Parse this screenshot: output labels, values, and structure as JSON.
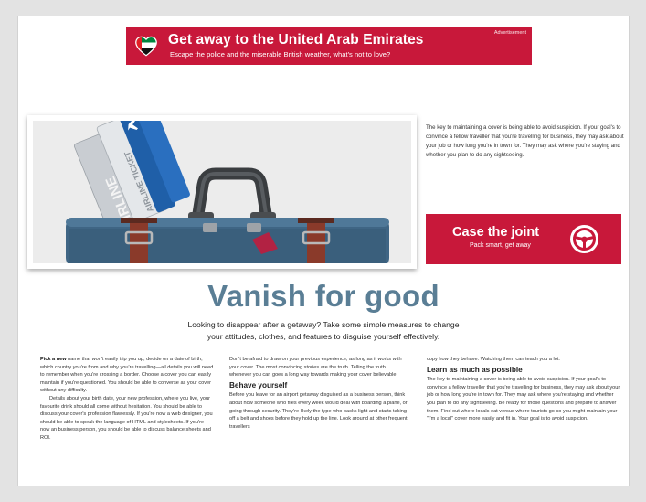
{
  "ad": {
    "title": "Get away to the United Arab Emirates",
    "subtitle": "Escape the police and the miserable British weather, what's not to love?",
    "tag": "Advertisement",
    "icon": "uae-flag-heart-icon",
    "color": "#c8183a"
  },
  "hero": {
    "ticket_front_text": "AIRLINE TICKET",
    "ticket_back_text": "AIRLINE"
  },
  "sidebar": {
    "intro": "The key to maintaining a cover is being able to avoid suspicion. If your goal's to convince a fellow traveller that you're travelling for business, they may ask about your job or how long you're in town for. They may ask where you're staying and whether you plan to do any sightseeing.",
    "cta_title": "Case the joint",
    "cta_subtitle": "Pack smart, get away",
    "cta_icon": "steering-wheel-icon"
  },
  "article": {
    "headline": "Vanish for good",
    "deck": "Looking to disappear after a getaway? Take some simple measures to change your attitudes, clothes, and features to disguise yourself effectively.",
    "col1_lead": "Pick a new",
    "col1_p1": " name that won't easily trip you up, decide on a date of birth, which country you're from and why you're travelling—all details you will need to remember when you're crossing a border. Choose a cover you can easily maintain if you're questioned. You should be able to converse as your cover without any difficulty.",
    "col1_p2": "Details about your birth date, your new profession, where you live, your favourite drink should all come without hesitation. You should be able to discuss your cover's profession flawlessly. If you're now a web designer, you should be able to speak the language of HTML and stylesheets. If you're now an business person, you should be able to discuss balance sheets and ROI.",
    "col2_p1": "Don't be afraid to draw on your previous experience, as long as it works with your cover. The most convincing stories are the truth. Telling the truth whenever you can goes a long way towards making your cover believable.",
    "col2_heading": "Behave yourself",
    "col2_p2": "Before you leave for an airport getaway disguised as a business person, think about how someone who flies every week would deal with boarding a plane, or going through security. They're likely the type who packs light and starts taking off a belt and shoes before they hold up the line. Look around at other frequent travellers",
    "col3_p1": "copy how they behave. Watching them can teach you a lot.",
    "col3_heading": "Learn as much as possible",
    "col3_p2": "The key to maintaining a cover is being able to avoid suspicion. If your goal's to convince a fellow traveller that you're travelling for business, they may ask about your job or how long you're in town for. They may ask where you're staying and whether you plan to do any sightseeing. Be ready for those questions and prepare to answer them. Find out where locals eat versus where tourists go so you might maintain your \"I'm a local\" cover more easily and fit in. Your goal is to avoid suspicion."
  },
  "colors": {
    "accent": "#c8183a",
    "headline": "#5a7e95",
    "background": "#e3e3e3"
  }
}
